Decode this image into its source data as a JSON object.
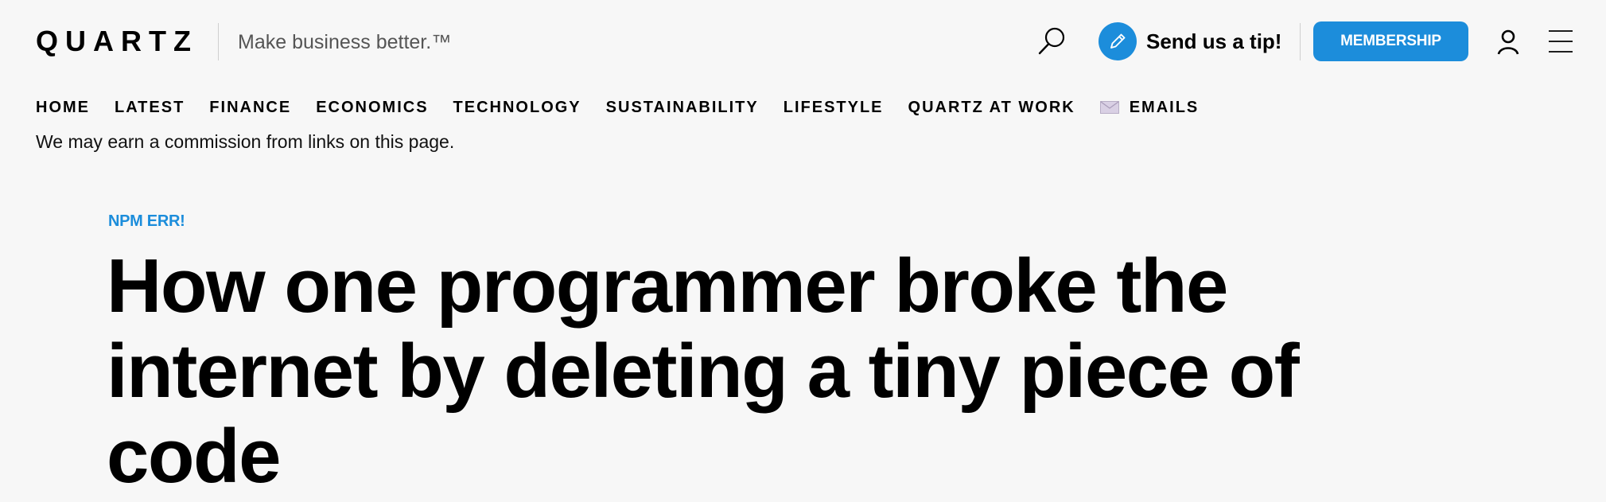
{
  "header": {
    "logo": "QUARTZ",
    "tagline": "Make business better.™",
    "tip_label": "Send us a tip!",
    "membership_label": "MEMBERSHIP"
  },
  "icons": {
    "search": "search-icon",
    "tip": "pencil-icon",
    "account": "user-icon",
    "menu": "hamburger-icon",
    "emails": "mail-icon"
  },
  "colors": {
    "accent": "#1c8ddb",
    "background": "#f7f7f7",
    "text": "#000000"
  },
  "nav": {
    "items": [
      {
        "label": "HOME"
      },
      {
        "label": "LATEST"
      },
      {
        "label": "FINANCE"
      },
      {
        "label": "ECONOMICS"
      },
      {
        "label": "TECHNOLOGY"
      },
      {
        "label": "SUSTAINABILITY"
      },
      {
        "label": "LIFESTYLE"
      },
      {
        "label": "QUARTZ AT WORK"
      },
      {
        "label": "EMAILS"
      }
    ]
  },
  "disclosure": "We may earn a commission from links on this page.",
  "article": {
    "kicker": "NPM ERR!",
    "headline": "How one programmer broke the internet by deleting a tiny piece of code"
  }
}
